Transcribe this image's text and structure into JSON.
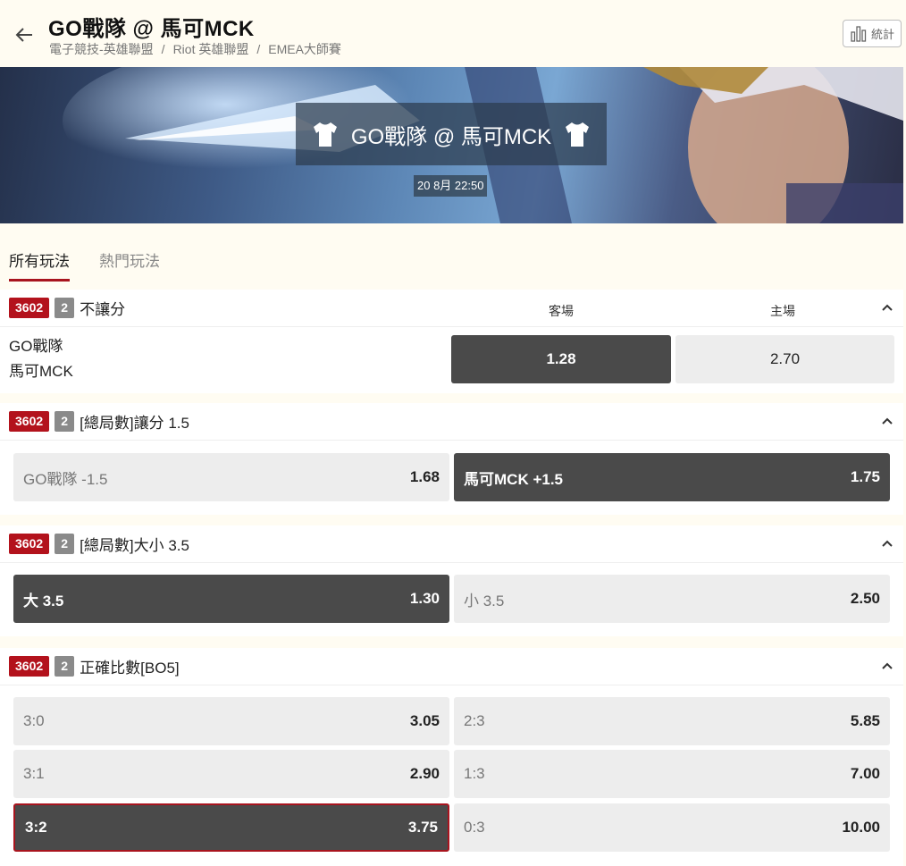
{
  "header": {
    "title": "GO戰隊 @ 馬可MCK",
    "breadcrumb": [
      "電子競技-英雄聯盟",
      "Riot 英雄聯盟",
      "EMEA大師賽"
    ],
    "stats_label": "統計"
  },
  "banner": {
    "match_title": "GO戰隊 @ 馬可MCK",
    "time": "20 8月 22:50"
  },
  "tabs": [
    {
      "label": "所有玩法",
      "active": true
    },
    {
      "label": "熱門玩法",
      "active": false
    }
  ],
  "markets": [
    {
      "id": "3602",
      "count": "2",
      "name": "不讓分",
      "columns": [
        "客場",
        "主場"
      ],
      "teams": [
        "GO戰隊",
        "馬可MCK"
      ],
      "odds": [
        "1.28",
        "2.70"
      ]
    },
    {
      "id": "3602",
      "count": "2",
      "name": "[總局數]讓分 1.5",
      "options": [
        {
          "label": "GO戰隊 -1.5",
          "value": "1.68"
        },
        {
          "label": "馬可MCK +1.5",
          "value": "1.75"
        }
      ]
    },
    {
      "id": "3602",
      "count": "2",
      "name": "[總局數]大小 3.5",
      "options": [
        {
          "label": "大 3.5",
          "value": "1.30"
        },
        {
          "label": "小 3.5",
          "value": "2.50"
        }
      ]
    },
    {
      "id": "3602",
      "count": "2",
      "name": "正確比數[BO5]",
      "options": [
        {
          "label": "3:0",
          "value": "3.05"
        },
        {
          "label": "2:3",
          "value": "5.85"
        },
        {
          "label": "3:1",
          "value": "2.90"
        },
        {
          "label": "1:3",
          "value": "7.00"
        },
        {
          "label": "3:2",
          "value": "3.75"
        },
        {
          "label": "0:3",
          "value": "10.00"
        }
      ]
    }
  ],
  "colors": {
    "accent": "#b3121c",
    "selected_bg": "#4a4a4a",
    "option_bg": "#ededed",
    "page_bg": "#fffcf2"
  }
}
